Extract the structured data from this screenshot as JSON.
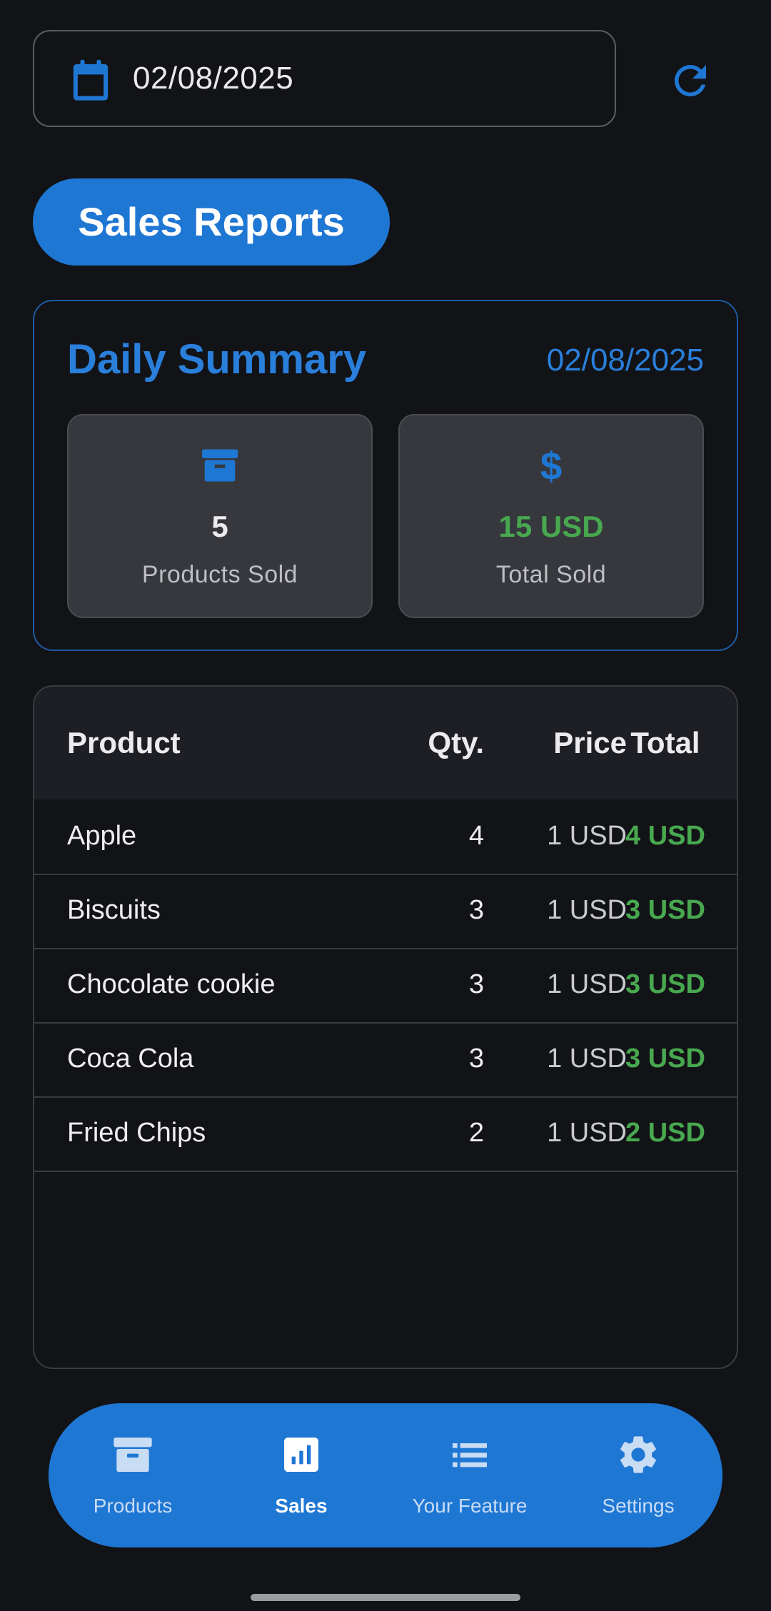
{
  "header": {
    "date_value": "02/08/2025",
    "calendar_icon": "calendar-icon",
    "refresh_icon": "refresh-icon"
  },
  "page_title": "Sales Reports",
  "summary": {
    "title": "Daily Summary",
    "date": "02/08/2025",
    "stats": [
      {
        "icon": "archive-box-icon",
        "value": "5",
        "label": "Products Sold"
      },
      {
        "icon": "dollar-icon",
        "value": "15 USD",
        "label": "Total Sold"
      }
    ]
  },
  "table": {
    "columns": [
      "Product",
      "Qty.",
      "Price",
      "Total"
    ],
    "rows": [
      {
        "product": "Apple",
        "qty": "4",
        "price": "1 USD",
        "total": "4 USD"
      },
      {
        "product": "Biscuits",
        "qty": "3",
        "price": "1 USD",
        "total": "3 USD"
      },
      {
        "product": "Chocolate cookie",
        "qty": "3",
        "price": "1 USD",
        "total": "3 USD"
      },
      {
        "product": "Coca Cola",
        "qty": "3",
        "price": "1 USD",
        "total": "3 USD"
      },
      {
        "product": "Fried Chips",
        "qty": "2",
        "price": "1 USD",
        "total": "2 USD"
      }
    ]
  },
  "bottom_nav": {
    "items": [
      {
        "label": "Products",
        "icon": "archive-box-icon",
        "active": false
      },
      {
        "label": "Sales",
        "icon": "bar-chart-icon",
        "active": true
      },
      {
        "label": "Your Feature",
        "icon": "list-icon",
        "active": false
      },
      {
        "label": "Settings",
        "icon": "gear-icon",
        "active": false
      }
    ]
  },
  "colors": {
    "background": "#121317",
    "accent": "#1f77d4",
    "positive": "#48a84f",
    "card": "#36383d"
  }
}
